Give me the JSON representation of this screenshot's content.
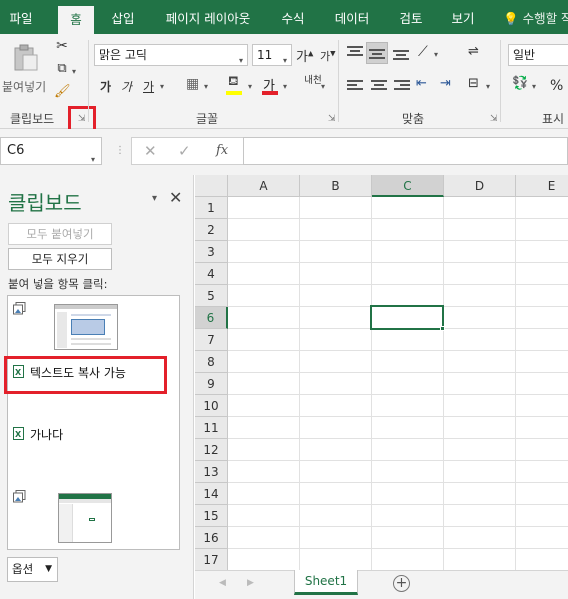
{
  "tabs": [
    "파일",
    "홈",
    "삽입",
    "페이지 레이아웃",
    "수식",
    "데이터",
    "검토",
    "보기"
  ],
  "active_tab": "홈",
  "tell_me": "수행할 작",
  "ribbon": {
    "clipboard": {
      "paste_label": "붙여넣기",
      "group_label": "클립보드"
    },
    "font": {
      "font_name": "맑은 고딕",
      "font_size": "11",
      "grow_label": "가",
      "shrink_label": "가",
      "bold": "가",
      "italic": "가",
      "underline": "가",
      "font_color_label": "가",
      "phonetic_label": "내천",
      "group_label": "글꼴",
      "fill_color": "#ffff00",
      "font_color": "#e3202a"
    },
    "alignment": {
      "group_label": "맞춤"
    },
    "number": {
      "format": "일반",
      "percent": "%",
      "group_label": "표시"
    }
  },
  "formula_bar": {
    "name_box": "C6",
    "fx_label": "fx",
    "content": ""
  },
  "clipboard_pane": {
    "title": "클립보드",
    "paste_all": "모두 붙여넣기",
    "clear_all": "모두 지우기",
    "hint": "붙여 넣을 항목 클릭:",
    "items": [
      {
        "type": "image",
        "icon": "picture-icon"
      },
      {
        "type": "text",
        "icon": "excel-icon",
        "text": "텍스트도 복사 가능"
      },
      {
        "type": "text",
        "icon": "excel-icon",
        "text": "가나다"
      },
      {
        "type": "image",
        "icon": "picture-icon"
      }
    ],
    "options": "옵션"
  },
  "grid": {
    "columns": [
      "A",
      "B",
      "C",
      "D",
      "E"
    ],
    "rows": [
      "1",
      "2",
      "3",
      "4",
      "5",
      "6",
      "7",
      "8",
      "9",
      "10",
      "11",
      "12",
      "13",
      "14",
      "15",
      "16",
      "17"
    ],
    "selected_column": "C",
    "selected_row": "6"
  },
  "sheets": [
    "Sheet1"
  ],
  "colors": {
    "accent": "#217346",
    "highlight": "#e3202a"
  }
}
